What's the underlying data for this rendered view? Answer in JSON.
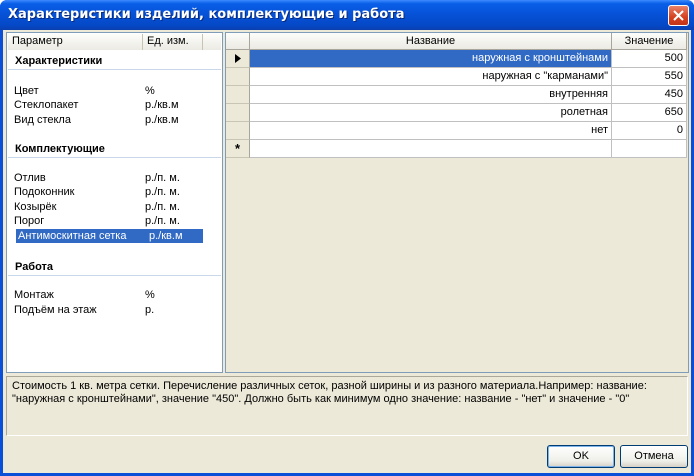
{
  "window": {
    "title": "Характеристики изделий, комплектующие и работа"
  },
  "left_panel": {
    "headers": {
      "param": "Параметр",
      "unit": "Ед. изм."
    },
    "sections": [
      {
        "title": "Характеристики",
        "items": [
          {
            "name": "Цвет",
            "unit": "%"
          },
          {
            "name": "Стеклопакет",
            "unit": "р./кв.м"
          },
          {
            "name": "Вид стекла",
            "unit": "р./кв.м"
          }
        ]
      },
      {
        "title": "Комплектующие",
        "items": [
          {
            "name": "Отлив",
            "unit": "р./п. м."
          },
          {
            "name": "Подоконник",
            "unit": "р./п. м."
          },
          {
            "name": "Козырёк",
            "unit": "р./п. м."
          },
          {
            "name": "Порог",
            "unit": "р./п. м."
          },
          {
            "name": "Антимоскитная сетка",
            "unit": "р./кв.м",
            "selected": true
          }
        ]
      },
      {
        "title": "Работа",
        "items": [
          {
            "name": "Монтаж",
            "unit": "%"
          },
          {
            "name": "Подъём на этаж",
            "unit": "р."
          }
        ]
      }
    ]
  },
  "grid": {
    "headers": {
      "name": "Название",
      "value": "Значение"
    },
    "rows": [
      {
        "name": "наружная с кронштейнами",
        "value": "500",
        "current": true
      },
      {
        "name": "наружная с \"карманами\"",
        "value": "550"
      },
      {
        "name": "внутренняя",
        "value": "450"
      },
      {
        "name": "ролетная",
        "value": "650"
      },
      {
        "name": "нет",
        "value": "0"
      }
    ],
    "new_row_marker": "*"
  },
  "description": {
    "line1": "Стоимость 1 кв. метра сетки. Перечисление различных сеток, разной ширины и из разного материала.Например: название:",
    "line2": "\"наружная с кронштейнами\", значение \"450\".  Должно быть как минимум одно значение: название - \"нет\" и значение - \"0\""
  },
  "buttons": {
    "ok": "OK",
    "cancel": "Отмена"
  },
  "colors": {
    "selection": "#316ac5",
    "titlebar": "#0651d6",
    "face": "#ece9d8"
  }
}
